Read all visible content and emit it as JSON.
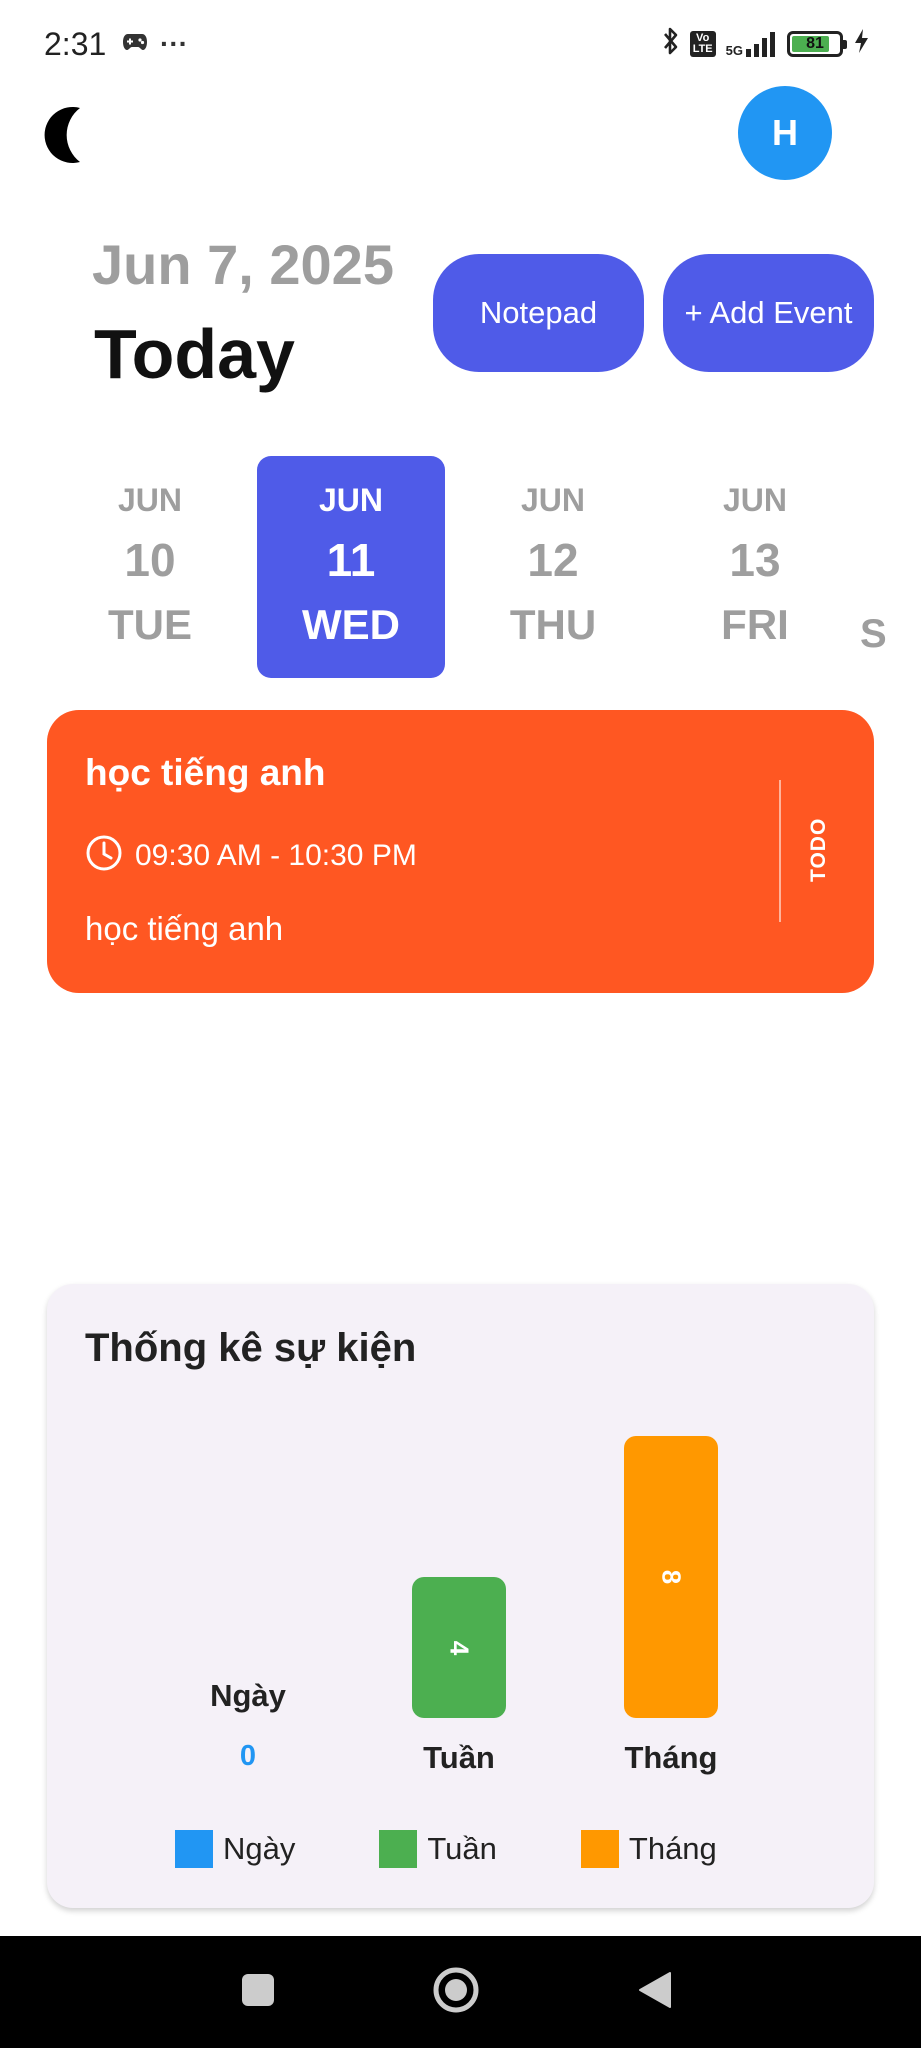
{
  "status_bar": {
    "time": "2:31",
    "overflow": "···",
    "network": "5G",
    "battery": "81",
    "battery_level": 0.81
  },
  "header": {
    "avatar_initial": "H",
    "date_label": "Jun 7, 2025",
    "title": "Today",
    "notepad_label": "Notepad",
    "add_event_label": "+ Add Event"
  },
  "date_strip": {
    "days": [
      {
        "month": "JUN",
        "day": "10",
        "weekday": "TUE"
      },
      {
        "month": "JUN",
        "day": "11",
        "weekday": "WED"
      },
      {
        "month": "JUN",
        "day": "12",
        "weekday": "THU"
      },
      {
        "month": "JUN",
        "day": "13",
        "weekday": "FRI"
      }
    ],
    "selected_index": 1,
    "peek_letter": "S"
  },
  "event": {
    "title": "học tiếng anh",
    "time": "09:30 AM - 10:30 PM",
    "description": "học tiếng anh",
    "status": "TODO",
    "color": "#ff5722"
  },
  "stats": {
    "title": "Thống kê sự kiện"
  },
  "chart_data": {
    "type": "bar",
    "categories": [
      "Ngày",
      "Tuần",
      "Tháng"
    ],
    "values": [
      0,
      4,
      8
    ],
    "colors": [
      "#2196f3",
      "#4caf50",
      "#ff9800"
    ],
    "legend": [
      "Ngày",
      "Tuần",
      "Tháng"
    ],
    "legend_position": "bottom",
    "grid": false,
    "ylim": [
      0,
      8
    ]
  },
  "colors": {
    "accent": "#4f5be8",
    "avatar": "#2196f3"
  }
}
